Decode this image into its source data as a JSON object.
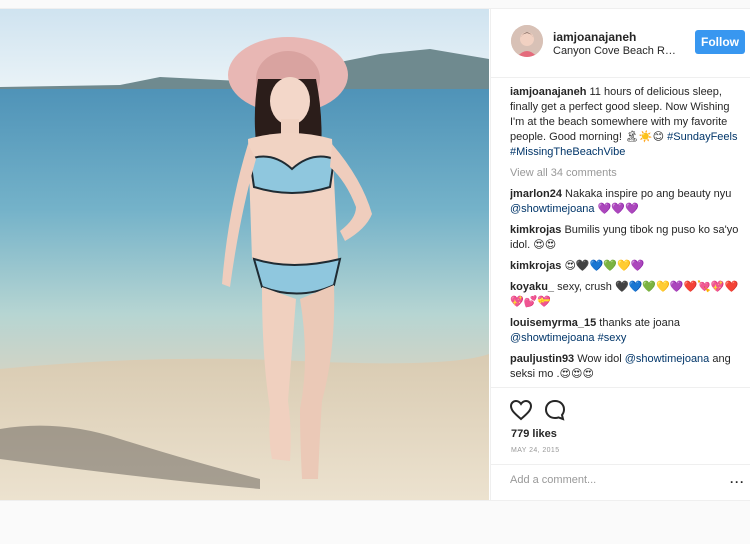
{
  "post": {
    "username": "iamjoanajaneh",
    "location": "Canyon Cove Beach Re...",
    "follow_label": "Follow",
    "caption": {
      "user": "iamjoanajaneh",
      "text": "11 hours of delicious sleep, finally get a perfect good sleep. Now Wishing I'm at the beach somewhere with my favorite people. Good morning! 🏝☀️😊",
      "hashtags": "#SundayFeels #MissingTheBeachVibe"
    },
    "view_all": "View all 34 comments",
    "comments": [
      {
        "user": "jmarlon24",
        "text": "Nakaka inspire po ang beauty nyu",
        "mention": "@showtimejoana",
        "tail": " 💜💜💜"
      },
      {
        "user": "kimkrojas",
        "text": "Bumilis yung tibok ng puso ko sa'yo idol. 😍😍"
      },
      {
        "user": "kimkrojas",
        "text": "😍🖤💙💚💛💜"
      },
      {
        "user": "koyaku_",
        "text": "sexy, crush 🖤💙💚💛💜❤️💘💖❤️💖💕💝"
      },
      {
        "user": "louisemyrma_15",
        "text": "thanks ate joana",
        "mention": "@showtimejoana",
        "tail2": "#sexy"
      },
      {
        "user": "pauljustin93",
        "text": "Wow idol",
        "mention": "@showtimejoana",
        "tail": " ang seksi mo .😍😍😍"
      }
    ],
    "likes": "779 likes",
    "date": "MAY 24, 2015",
    "add_comment_placeholder": "Add a comment...",
    "more_label": "···",
    "icons": {
      "like": "heart-icon",
      "comment": "comment-icon"
    }
  }
}
